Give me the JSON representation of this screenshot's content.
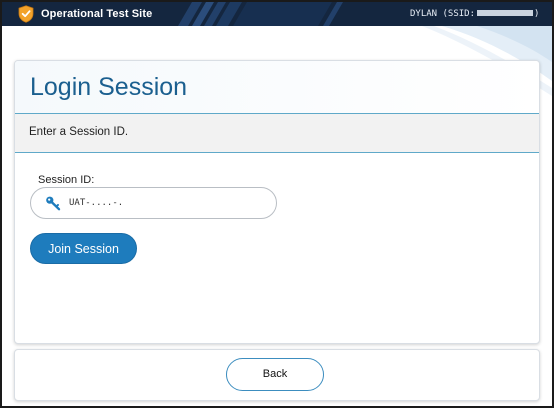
{
  "topbar": {
    "site_title": "Operational Test Site",
    "user_label": "DYLAN (SSID:",
    "user_suffix": ")"
  },
  "panel": {
    "title": "Login Session",
    "instruction": "Enter a Session ID.",
    "session_label": "Session ID:",
    "session_value": "UAT-....-.",
    "join_label": "Join Session"
  },
  "footer": {
    "back_label": "Back"
  },
  "icons": {
    "site_logo": "shield-check-icon",
    "session_field": "key-icon"
  },
  "colors": {
    "topbar_bg": "#14263f",
    "accent_blue": "#1e7cbd",
    "title_blue": "#1b5f8f",
    "logo_orange": "#f2a22b"
  }
}
